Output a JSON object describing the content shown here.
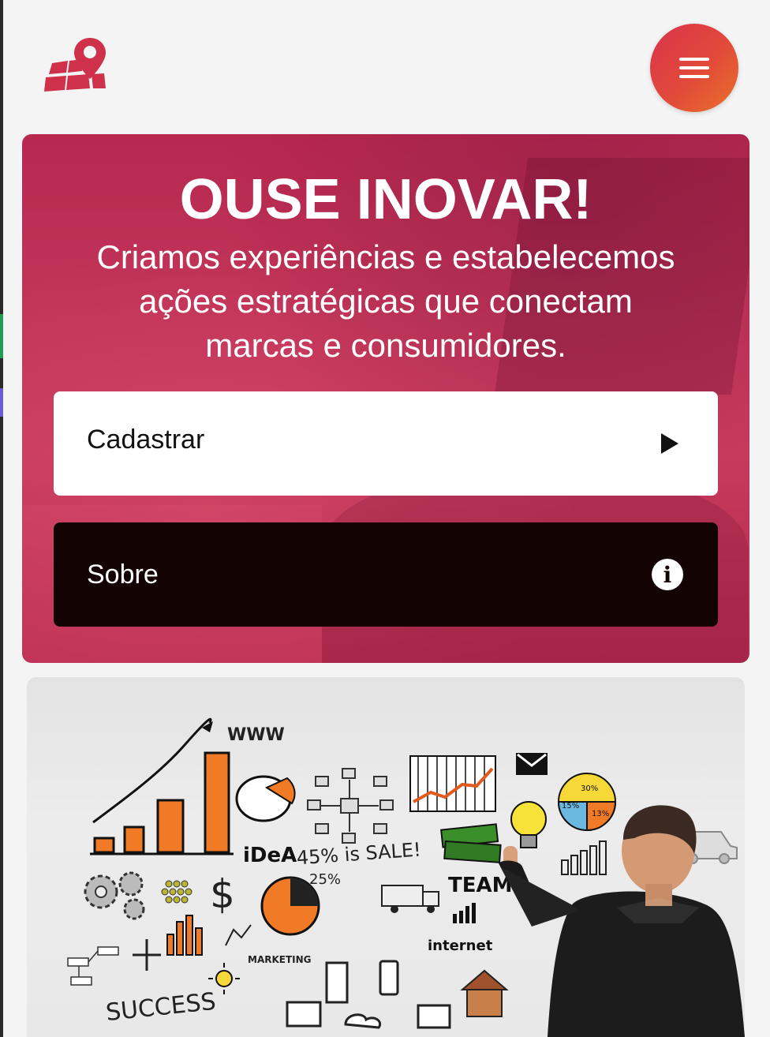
{
  "header": {
    "logo_icon": "location-pin-logo-icon",
    "menu_icon": "hamburger-menu-icon",
    "menu_gradient": [
      "#d8344c",
      "#e8722a"
    ]
  },
  "hero": {
    "title": "OUSE INOVAR!",
    "subtitle_lines": [
      "Criamos experiências e estabelecemos",
      "ações estratégicas que conectam",
      "marcas e consumidores."
    ],
    "buttons": [
      {
        "label": "Cadastrar",
        "icon": "play-icon"
      },
      {
        "label": "Sobre",
        "icon": "info-icon"
      }
    ],
    "accent_color": "#c23559"
  },
  "illustration": {
    "texts": {
      "www": "WWW",
      "idea": "iDeA",
      "sale": "45% is SALE!",
      "percent": "25%",
      "team": "TEAM",
      "internet": "internet",
      "marketing": "MARKETING",
      "success": "SUCCESS",
      "pie_a": "30%",
      "pie_b": "15%",
      "pie_c": "13%"
    }
  }
}
